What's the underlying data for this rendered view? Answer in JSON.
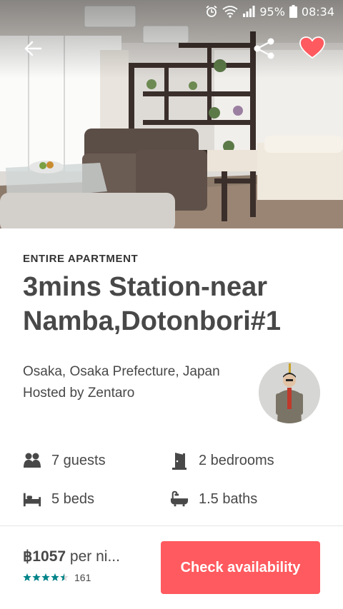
{
  "status_bar": {
    "battery": "95%",
    "time": "08:34",
    "icons": [
      "alarm-icon",
      "wifi-icon",
      "signal-icon",
      "battery-icon"
    ]
  },
  "hero": {
    "back_icon": "arrow-left-icon",
    "share_icon": "share-icon",
    "favorite_icon": "heart-icon",
    "favorite_color": "#ff5a5f"
  },
  "listing": {
    "room_type": "ENTIRE APARTMENT",
    "title": "3mins Station-near Namba,Dotonbori#1",
    "location": "Osaka, Osaka Prefecture, Japan",
    "host": "Hosted by Zentaro"
  },
  "amenities": [
    {
      "icon": "guests-icon",
      "label": "7 guests"
    },
    {
      "icon": "door-icon",
      "label": "2 bedrooms"
    },
    {
      "icon": "bed-icon",
      "label": "5 beds"
    },
    {
      "icon": "bathtub-icon",
      "label": "1.5 baths"
    }
  ],
  "booking": {
    "price": "฿1057",
    "price_suffix": " per ni...",
    "rating_stars": 4.5,
    "review_count": "161",
    "cta_label": "Check availability",
    "accent_color": "#ff5a5f",
    "star_color": "#008489"
  }
}
